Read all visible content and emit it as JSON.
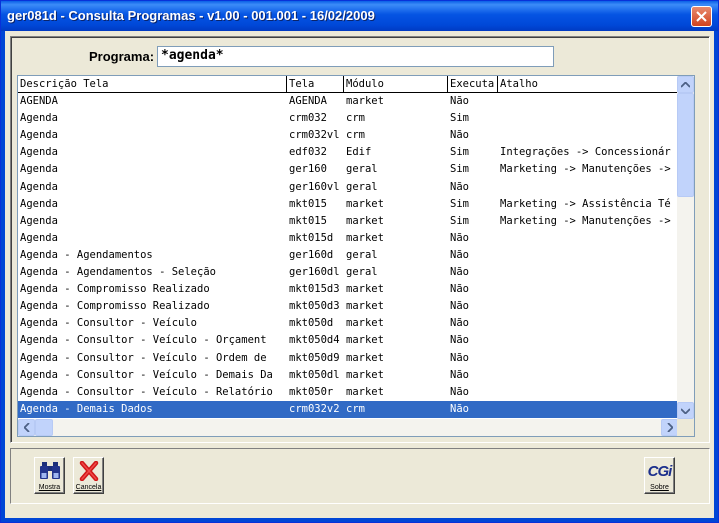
{
  "window": {
    "title": "ger081d - Consulta Programas -  v1.00 - 001.001 - 16/02/2009"
  },
  "search": {
    "label": "Programa:",
    "value": "*agenda*"
  },
  "grid": {
    "columns": [
      "Descrição Tela",
      "Tela",
      "Módulo",
      "Executa",
      "Atalho"
    ],
    "rows": [
      [
        "AGENDA",
        "AGENDA",
        "market",
        "Não",
        ""
      ],
      [
        "Agenda",
        "crm032",
        "crm",
        "Sim",
        ""
      ],
      [
        "Agenda",
        "crm032vl",
        "crm",
        "Não",
        ""
      ],
      [
        "Agenda",
        "edf032",
        "Edif",
        "Sim",
        "Integrações -> Concessionár"
      ],
      [
        "Agenda",
        "ger160",
        "geral",
        "Sim",
        "Marketing -> Manutenções ->"
      ],
      [
        "Agenda",
        "ger160vl",
        "geral",
        "Não",
        ""
      ],
      [
        "Agenda",
        "mkt015",
        "market",
        "Sim",
        "Marketing -> Assistência Té"
      ],
      [
        "Agenda",
        "mkt015",
        "market",
        "Sim",
        "Marketing -> Manutenções ->"
      ],
      [
        "Agenda",
        "mkt015d",
        "market",
        "Não",
        ""
      ],
      [
        "Agenda - Agendamentos",
        "ger160d",
        "geral",
        "Não",
        ""
      ],
      [
        "Agenda - Agendamentos - Seleção",
        "ger160dl",
        "geral",
        "Não",
        ""
      ],
      [
        "Agenda - Compromisso Realizado",
        "mkt015d3",
        "market",
        "Não",
        ""
      ],
      [
        "Agenda - Compromisso Realizado",
        "mkt050d3",
        "market",
        "Não",
        ""
      ],
      [
        "Agenda - Consultor - Veículo",
        "mkt050d",
        "market",
        "Não",
        ""
      ],
      [
        "Agenda - Consultor - Veículo  - Orçament",
        "mkt050d4",
        "market",
        "Não",
        ""
      ],
      [
        "Agenda - Consultor - Veículo  - Ordem de",
        "mkt050d9",
        "market",
        "Não",
        ""
      ],
      [
        "Agenda - Consultor - Veículo - Demais Da",
        "mkt050dl",
        "market",
        "Não",
        ""
      ],
      [
        "Agenda - Consultor - Veículo - Relatório",
        "mkt050r",
        "market",
        "Não",
        ""
      ],
      [
        "Agenda - Demais Dados",
        "crm032v2",
        "crm",
        "Não",
        ""
      ]
    ],
    "selected_row": 18
  },
  "toolbar": {
    "mostra_label": "Mostra",
    "cancela_label": "Cancela",
    "sobre_label": "Sobre",
    "logo_text": "CGi"
  },
  "colors": {
    "selection": "#316AC5",
    "title_bar": "#0054E3",
    "window_bg": "#ECE9D8"
  }
}
